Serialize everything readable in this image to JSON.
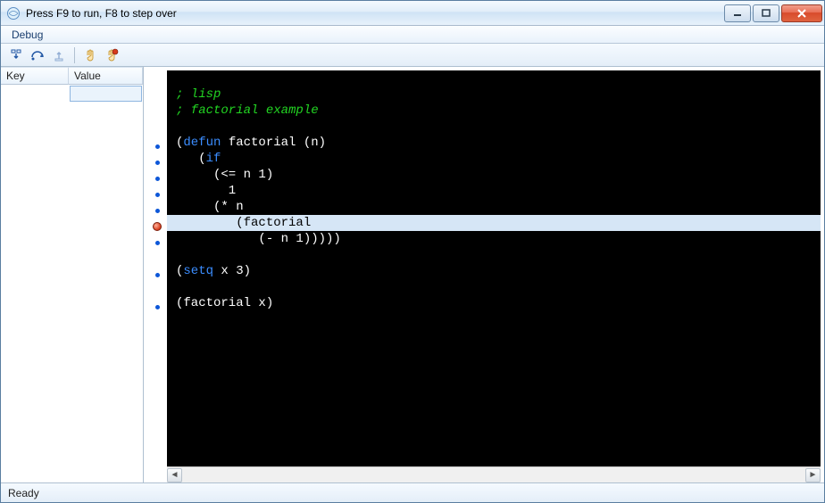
{
  "window": {
    "title": "Press F9 to run, F8 to step over"
  },
  "menu": {
    "items": [
      "Debug"
    ]
  },
  "toolbar": {
    "icons": [
      "step-into",
      "step-over",
      "step-out",
      "sep",
      "pause-hand",
      "stop-hand"
    ]
  },
  "vars_panel": {
    "columns": {
      "key": "Key",
      "value": "Value"
    },
    "rows": [
      {
        "key": "",
        "value": ""
      }
    ]
  },
  "editor": {
    "highlight_index": 8,
    "lines": [
      {
        "marker": "none",
        "segments": []
      },
      {
        "marker": "none",
        "segments": [
          {
            "cls": "cm",
            "text": "; lisp"
          }
        ]
      },
      {
        "marker": "none",
        "segments": [
          {
            "cls": "cm",
            "text": "; factorial example"
          }
        ]
      },
      {
        "marker": "none",
        "segments": []
      },
      {
        "marker": "dot",
        "segments": [
          {
            "cls": "",
            "text": "("
          },
          {
            "cls": "kw",
            "text": "defun"
          },
          {
            "cls": "",
            "text": " factorial (n)"
          }
        ]
      },
      {
        "marker": "dot",
        "segments": [
          {
            "cls": "",
            "text": "   ("
          },
          {
            "cls": "kw",
            "text": "if"
          }
        ]
      },
      {
        "marker": "dot",
        "segments": [
          {
            "cls": "",
            "text": "     (<= n 1)"
          }
        ]
      },
      {
        "marker": "dot",
        "segments": [
          {
            "cls": "",
            "text": "       1"
          }
        ]
      },
      {
        "marker": "dot",
        "segments": [
          {
            "cls": "",
            "text": "     (* n"
          }
        ]
      },
      {
        "marker": "bp",
        "segments": [
          {
            "cls": "",
            "text": "        (factorial"
          }
        ]
      },
      {
        "marker": "dot",
        "segments": [
          {
            "cls": "",
            "text": "           (- n 1)))))"
          }
        ]
      },
      {
        "marker": "none",
        "segments": []
      },
      {
        "marker": "dot",
        "segments": [
          {
            "cls": "",
            "text": "("
          },
          {
            "cls": "kw",
            "text": "setq"
          },
          {
            "cls": "",
            "text": " x 3)"
          }
        ]
      },
      {
        "marker": "none",
        "segments": []
      },
      {
        "marker": "dot",
        "segments": [
          {
            "cls": "",
            "text": "(factorial x)"
          }
        ]
      }
    ]
  },
  "status": {
    "text": "Ready"
  }
}
